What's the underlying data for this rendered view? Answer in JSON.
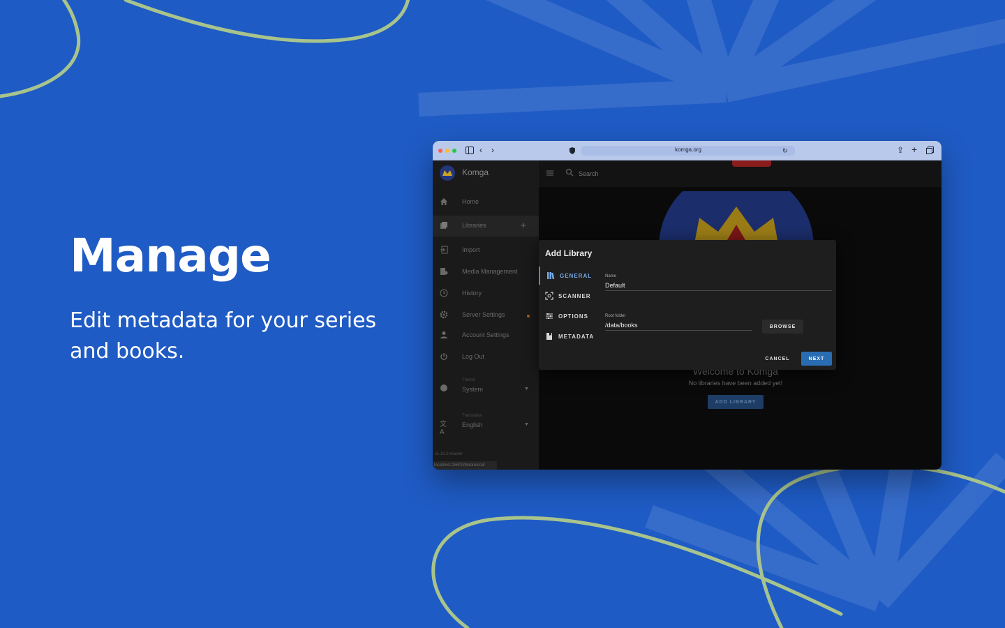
{
  "hero": {
    "title": "Manage",
    "subtitle": "Edit metadata for your series and books."
  },
  "browser": {
    "url": "komga.org",
    "icons": [
      "sidebar-toggle-icon",
      "back-icon",
      "forward-icon",
      "shield-icon",
      "lock-icon",
      "reload-icon",
      "share-icon",
      "new-tab-icon",
      "tabs-overview-icon"
    ]
  },
  "app": {
    "name": "Komga",
    "nav": [
      {
        "label": "Home",
        "icon": "home-icon"
      },
      {
        "label": "Libraries",
        "icon": "libraries-icon"
      },
      {
        "label": "Import",
        "icon": "import-icon"
      },
      {
        "label": "Media Management",
        "icon": "media-management-icon"
      },
      {
        "label": "History",
        "icon": "history-icon"
      },
      {
        "label": "Server Settings",
        "icon": "gear-icon"
      },
      {
        "label": "Account Settings",
        "icon": "account-icon"
      },
      {
        "label": "Log Out",
        "icon": "power-icon"
      }
    ],
    "theme": {
      "caption": "Theme",
      "value": "System"
    },
    "translation": {
      "caption": "Translation",
      "value": "English"
    },
    "version": "v1.10.3-master",
    "status_url": "localhost:25600/libraries/all",
    "search_placeholder": "Search",
    "welcome": "Welcome to Komga",
    "no_libraries": "No libraries have been added yet!",
    "add_library_button": "ADD LIBRARY"
  },
  "dialog": {
    "title": "Add Library",
    "tabs": [
      {
        "label": "GENERAL",
        "icon": "library-icon"
      },
      {
        "label": "SCANNER",
        "icon": "scanner-icon"
      },
      {
        "label": "OPTIONS",
        "icon": "options-icon"
      },
      {
        "label": "METADATA",
        "icon": "metadata-icon"
      }
    ],
    "name_label": "Name",
    "name_value": "Default",
    "root_label": "Root folder",
    "root_value": "/data/books",
    "browse": "BROWSE",
    "cancel": "CANCEL",
    "next": "NEXT"
  },
  "colors": {
    "background": "#1f5bc4",
    "accent_curve": "#a8c48c",
    "primary": "#2a6cb2"
  }
}
